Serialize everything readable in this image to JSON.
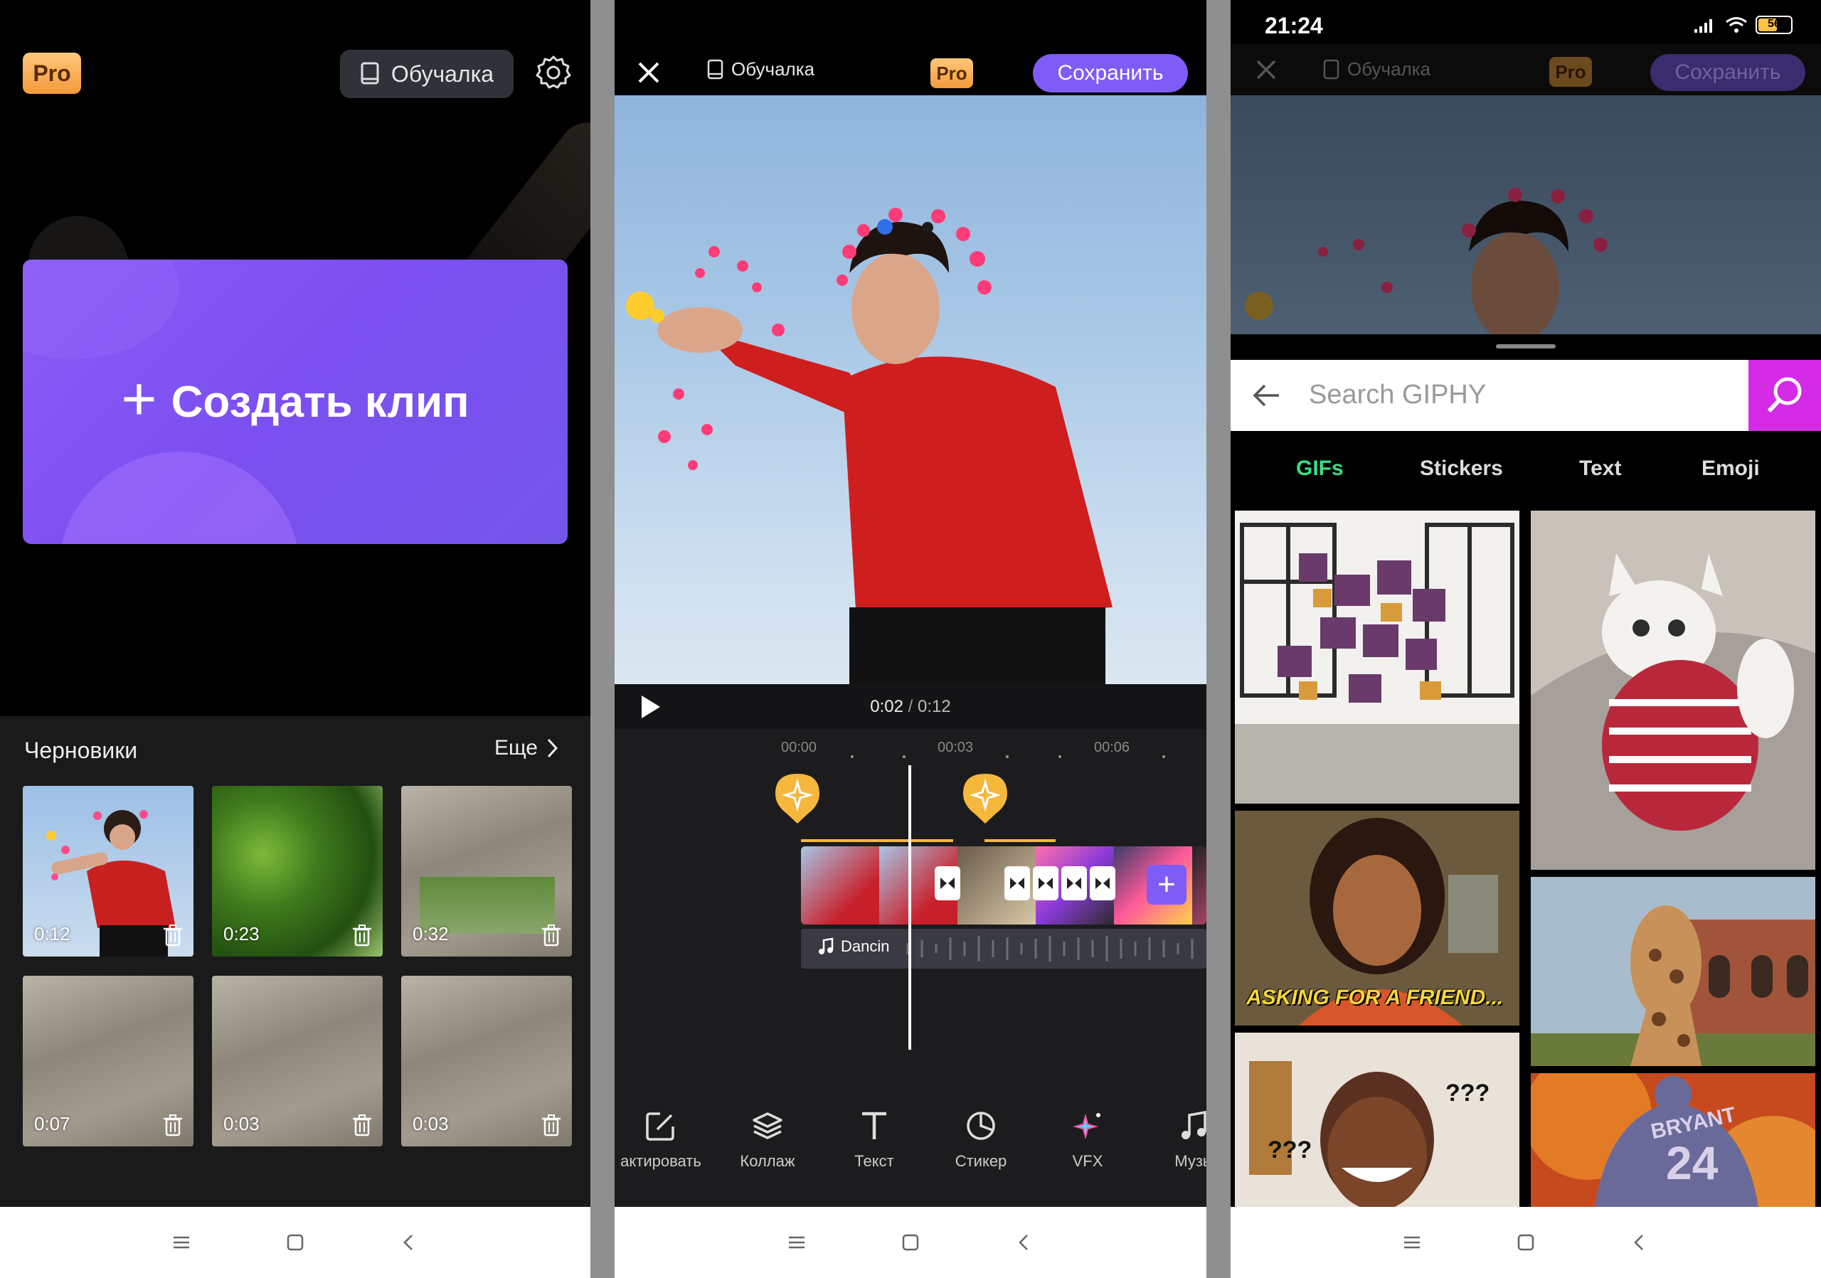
{
  "panel1": {
    "pro_badge": "Pro",
    "tutorial_label": "Обучалка",
    "create_label": "Создать клип",
    "drafts_title": "Черновики",
    "drafts_more": "Еще",
    "drafts": [
      {
        "duration": "0:12",
        "kind": "photo"
      },
      {
        "duration": "0:23",
        "kind": "grass"
      },
      {
        "duration": "0:32",
        "kind": "water-pond"
      },
      {
        "duration": "0:07",
        "kind": "water"
      },
      {
        "duration": "0:03",
        "kind": "water"
      },
      {
        "duration": "0:03",
        "kind": "water"
      }
    ]
  },
  "panel2": {
    "tutorial_label": "Обучалка",
    "pro_badge": "Pro",
    "save_label": "Сохранить",
    "time_current": "0:02",
    "time_sep": "/",
    "time_total": "0:12",
    "ruler": [
      "00:00",
      "00:03",
      "00:06"
    ],
    "audio_label": "Dancin",
    "tools": [
      {
        "label": "актировать",
        "icon": "edit-icon"
      },
      {
        "label": "Коллаж",
        "icon": "layers-icon"
      },
      {
        "label": "Текст",
        "icon": "text-icon"
      },
      {
        "label": "Стикер",
        "icon": "sticker-icon"
      },
      {
        "label": "VFX",
        "icon": "sparkle-icon"
      },
      {
        "label": "Музы",
        "icon": "music-icon"
      }
    ]
  },
  "panel3": {
    "clock": "21:24",
    "battery": "56",
    "tutorial_label": "Обучалка",
    "pro_badge": "Pro",
    "save_label": "Сохранить",
    "search_placeholder": "Search GIPHY",
    "tabs": [
      {
        "label": "GIFs",
        "active": true
      },
      {
        "label": "Stickers",
        "active": false
      },
      {
        "label": "Text",
        "active": false
      },
      {
        "label": "Emoji",
        "active": false
      }
    ],
    "gif_caption": "ASKING FOR A FRIEND...",
    "gif_text_qqq": "???",
    "gif_jersey_name": "BRYANT",
    "gif_jersey_number": "24"
  },
  "colors": {
    "accent_purple": "#7f5cf5",
    "pro_orange": "#f39a3b",
    "giphy_magenta": "#d42be6",
    "tab_active_green": "#3ddc84",
    "keyframe_yellow": "#f5b73c"
  }
}
